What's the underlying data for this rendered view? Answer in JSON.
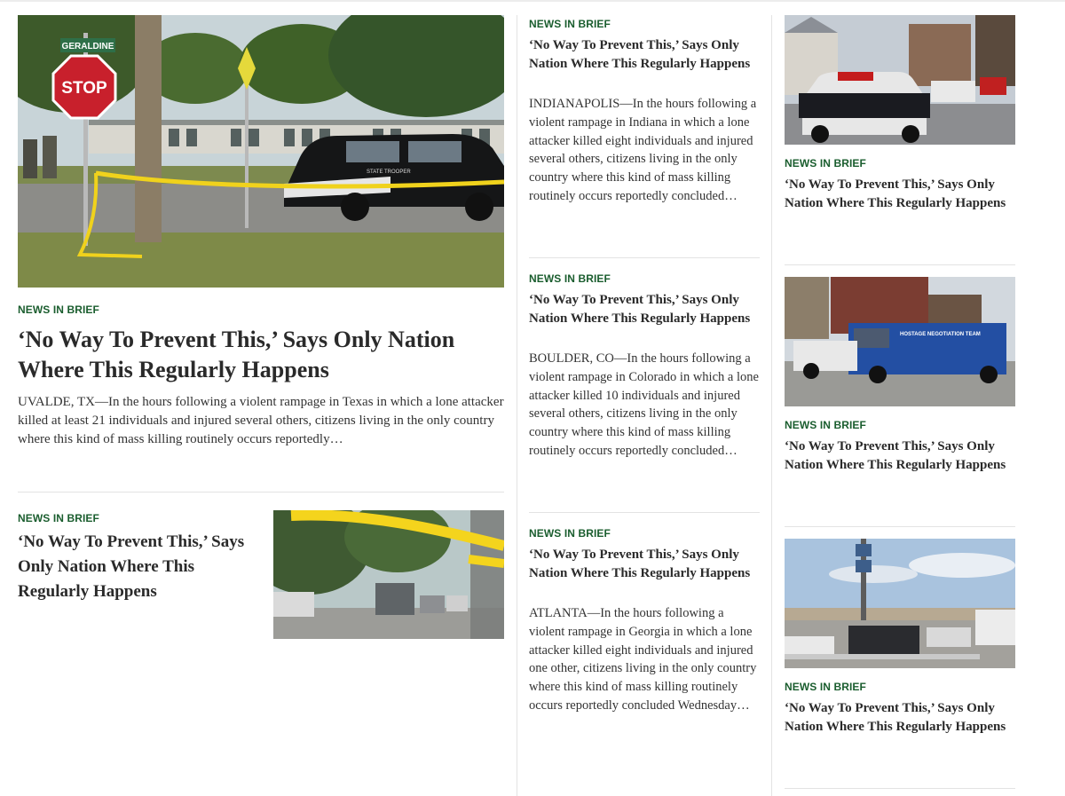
{
  "feature": {
    "kicker": "NEWS IN BRIEF",
    "headline": "‘No Way To Prevent This,’ Says Only Nation Where This Regularly Happens",
    "excerpt": "UVALDE, TX—In the hours following a violent rampage in Texas in which a lone attacker killed at least 21 individuals and injured several others, citizens living in the only country where this kind of mass killing routinely occurs reportedly…",
    "image_signs": {
      "street": "GERALDINE",
      "stop": "STOP",
      "car": "STATE TROOPER"
    }
  },
  "left_small": {
    "kicker": "NEWS IN BRIEF",
    "headline": "‘No Way To Prevent This,’ Says Only Nation Where This Regularly Happens"
  },
  "middle": [
    {
      "kicker": "NEWS IN BRIEF",
      "headline": "‘No Way To Prevent This,’ Says Only Nation Where This Regularly Happens",
      "excerpt": "INDIANAPOLIS—In the hours following a violent rampage in Indiana in which a lone attacker killed eight individuals and injured several others, citizens living in the only country where this kind of mass killing routinely occurs reportedly concluded…"
    },
    {
      "kicker": "NEWS IN BRIEF",
      "headline": "‘No Way To Prevent This,’ Says Only Nation Where This Regularly Happens",
      "excerpt": "BOULDER, CO—In the hours following a violent rampage in Colorado in which a lone attacker killed 10 individuals and injured several others, citizens living in the only country where this kind of mass killing routinely occurs reportedly concluded…"
    },
    {
      "kicker": "NEWS IN BRIEF",
      "headline": "‘No Way To Prevent This,’ Says Only Nation Where This Regularly Happens",
      "excerpt": "ATLANTA—In the hours following a violent rampage in Georgia in which a lone attacker killed eight individuals and injured one other, citizens living in the only country where this kind of mass killing routinely occurs reportedly concluded Wednesday…"
    }
  ],
  "right": [
    {
      "kicker": "NEWS IN BRIEF",
      "headline": "‘No Way To Prevent This,’ Says Only Nation Where This Regularly Happens"
    },
    {
      "kicker": "NEWS IN BRIEF",
      "headline": "‘No Way To Prevent This,’ Says Only Nation Where This Regularly Happens",
      "image_van_text": "HOSTAGE NEGOTIATION TEAM"
    },
    {
      "kicker": "NEWS IN BRIEF",
      "headline": "‘No Way To Prevent This,’ Says Only Nation Where This Regularly Happens"
    }
  ],
  "colors": {
    "kicker": "#1a5d2e",
    "headline": "#2a2a2a",
    "rule": "#e3e3e3"
  }
}
